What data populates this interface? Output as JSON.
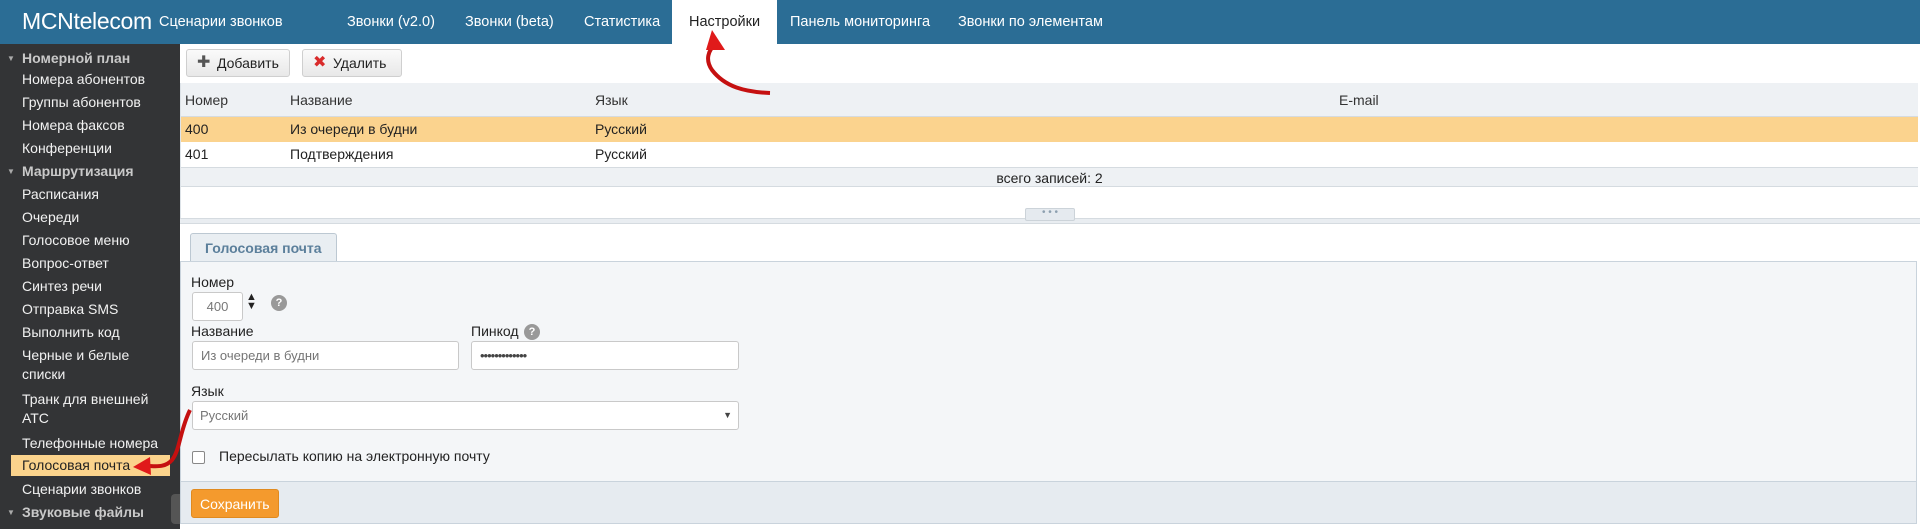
{
  "app": {
    "logo": "MCNtelecom"
  },
  "topnav": [
    {
      "label": "Сценарии звонков"
    },
    {
      "label": "Звонки (v2.0)"
    },
    {
      "label": "Звонки (beta)"
    },
    {
      "label": "Статистика"
    },
    {
      "label": "Настройки",
      "active": true
    },
    {
      "label": "Панель мониторинга"
    },
    {
      "label": "Звонки по элементам"
    }
  ],
  "sidebar": {
    "groups": [
      {
        "label": "Номерной план",
        "items": [
          "Номера абонентов",
          "Группы абонентов",
          "Номера факсов",
          "Конференции"
        ]
      },
      {
        "label": "Маршрутизация",
        "items": [
          "Расписания",
          "Очереди",
          "Голосовое меню",
          "Вопрос-ответ",
          "Синтез речи",
          "Отправка SMS",
          "Выполнить код",
          "Черные и белые списки",
          "Транк для внешней АТС",
          "Телефонные номера",
          "Голосовая почта",
          "Сценарии звонков"
        ]
      },
      {
        "label": "Звуковые файлы",
        "items": []
      }
    ],
    "active_item": "Голосовая почта"
  },
  "toolbar": {
    "add_label": "Добавить",
    "delete_label": "Удалить"
  },
  "grid": {
    "columns": [
      "Номер",
      "Название",
      "Язык",
      "E-mail"
    ],
    "rows": [
      [
        "400",
        "Из очереди в будни",
        "Русский",
        ""
      ],
      [
        "401",
        "Подтверждения",
        "Русский",
        ""
      ]
    ],
    "selected_row": 0,
    "footer": "всего записей: 2"
  },
  "form": {
    "tab_label": "Голосовая почта",
    "number_label": "Номер",
    "number_value": "400",
    "name_label": "Название",
    "name_placeholder": "Из очереди в будни",
    "pin_label": "Пинкод",
    "pin_value": "•••••••••••••",
    "lang_label": "Язык",
    "lang_value": "Русский",
    "forward_label": "Пересылать копию на электронную почту",
    "forward_checked": false,
    "save_label": "Сохранить",
    "help_glyph": "?"
  },
  "colors": {
    "topbar": "#2b6d95",
    "sidebar": "#333436",
    "selection": "#fbd38e",
    "save_button": "#f49a2d",
    "annotation_arrow": "#e01a1a"
  }
}
